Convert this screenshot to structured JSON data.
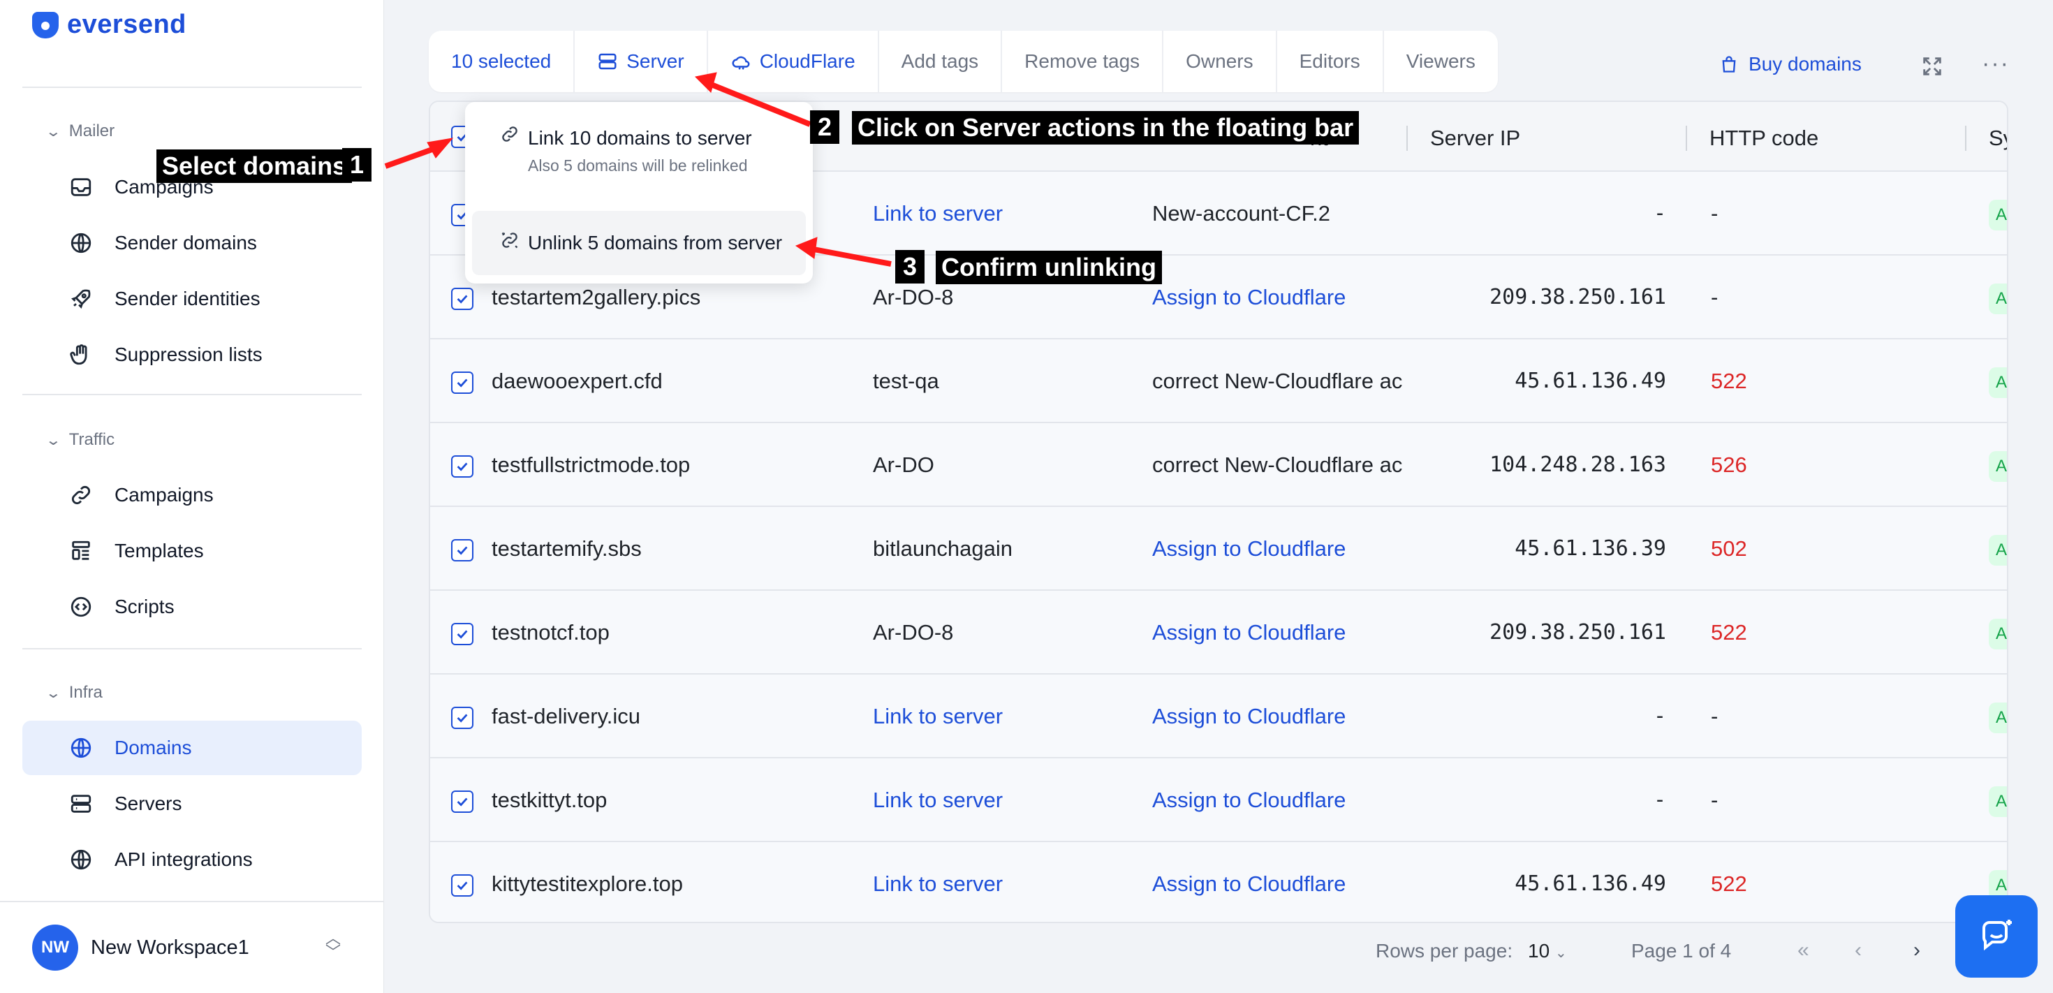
{
  "brand": {
    "name": "eversend"
  },
  "sidebar": {
    "sections": [
      {
        "title": "Mailer",
        "items": [
          {
            "label": "Campaigns",
            "icon": "inbox-icon"
          },
          {
            "label": "Sender domains",
            "icon": "globe-icon"
          },
          {
            "label": "Sender identities",
            "icon": "rocket-icon"
          },
          {
            "label": "Suppression lists",
            "icon": "hand-icon"
          }
        ]
      },
      {
        "title": "Traffic",
        "items": [
          {
            "label": "Campaigns",
            "icon": "link-icon"
          },
          {
            "label": "Templates",
            "icon": "template-icon"
          },
          {
            "label": "Scripts",
            "icon": "code-icon"
          }
        ]
      },
      {
        "title": "Infra",
        "items": [
          {
            "label": "Domains",
            "icon": "globe-icon",
            "active": true
          },
          {
            "label": "Servers",
            "icon": "server-icon"
          },
          {
            "label": "API integrations",
            "icon": "globe-icon"
          }
        ]
      }
    ],
    "workspace": {
      "initials": "NW",
      "name": "New Workspace1"
    }
  },
  "toolbar": {
    "selected": "10 selected",
    "server": "Server",
    "cloudflare": "CloudFlare",
    "add_tags": "Add tags",
    "remove_tags": "Remove tags",
    "owners": "Owners",
    "editors": "Editors",
    "viewers": "Viewers"
  },
  "header_actions": {
    "buy_domains": "Buy domains",
    "more": "···"
  },
  "dropdown": {
    "link_label": "Link 10 domains to server",
    "link_sub": "Also 5 domains will be relinked",
    "unlink_label": "Unlink 5 domains from server"
  },
  "table": {
    "columns": {
      "account_partial": "nt",
      "server_ip": "Server IP",
      "http_code": "HTTP code",
      "sy_partial": "Sy"
    },
    "rows": [
      {
        "domain": "",
        "server": "Link to server",
        "server_link": true,
        "cf": "New-account-CF.2",
        "cf_link": false,
        "ip": "-",
        "http": "-",
        "http_red": false
      },
      {
        "domain": "testartem2gallery.pics",
        "server": "Ar-DO-8",
        "server_link": false,
        "cf": "Assign to Cloudflare",
        "cf_link": true,
        "ip": "209.38.250.161",
        "http": "-",
        "http_red": false
      },
      {
        "domain": "daewooexpert.cfd",
        "server": "test-qa",
        "server_link": false,
        "cf": "correct New-Cloudflare ac",
        "cf_link": false,
        "ip": "45.61.136.49",
        "http": "522",
        "http_red": true
      },
      {
        "domain": "testfullstrictmode.top",
        "server": "Ar-DO",
        "server_link": false,
        "cf": "correct New-Cloudflare ac",
        "cf_link": false,
        "ip": "104.248.28.163",
        "http": "526",
        "http_red": true
      },
      {
        "domain": "testartemify.sbs",
        "server": "bitlaunchagain",
        "server_link": false,
        "cf": "Assign to Cloudflare",
        "cf_link": true,
        "ip": "45.61.136.39",
        "http": "502",
        "http_red": true
      },
      {
        "domain": "testnotcf.top",
        "server": "Ar-DO-8",
        "server_link": false,
        "cf": "Assign to Cloudflare",
        "cf_link": true,
        "ip": "209.38.250.161",
        "http": "522",
        "http_red": true
      },
      {
        "domain": "fast-delivery.icu",
        "server": "Link to server",
        "server_link": true,
        "cf": "Assign to Cloudflare",
        "cf_link": true,
        "ip": "-",
        "http": "-",
        "http_red": false
      },
      {
        "domain": "testkittyt.top",
        "server": "Link to server",
        "server_link": true,
        "cf": "Assign to Cloudflare",
        "cf_link": true,
        "ip": "-",
        "http": "-",
        "http_red": false
      },
      {
        "domain": "kittytestitexplore.top",
        "server": "Link to server",
        "server_link": true,
        "cf": "Assign to Cloudflare",
        "cf_link": true,
        "ip": "45.61.136.49",
        "http": "522",
        "http_red": true
      }
    ],
    "status_pill": "A"
  },
  "footer": {
    "rows_per_page_label": "Rows per page:",
    "rows_per_page_value": "10",
    "page_info": "Page 1 of 4",
    "first": "«",
    "prev": "‹",
    "next": "›"
  },
  "annotations": {
    "step1_label": "Select domains",
    "step1_num": "1",
    "step2_label": "Click on Server actions in the floating bar",
    "step2_num": "2",
    "step3_label": "Confirm unlinking",
    "step3_num": "3"
  },
  "colors": {
    "accent": "#1d4ed8",
    "error": "#dc2626",
    "success": "#16a34a",
    "annotation_arrow": "#ff1a1a"
  }
}
